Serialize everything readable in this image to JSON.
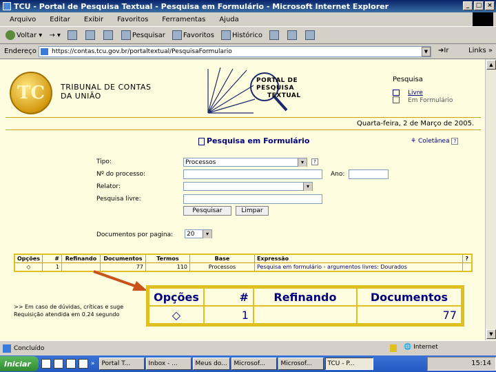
{
  "window": {
    "title": "TCU - Portal de Pesquisa Textual - Pesquisa em Formulário - Microsoft Internet Explorer"
  },
  "menu": [
    "Arquivo",
    "Editar",
    "Exibir",
    "Favoritos",
    "Ferramentas",
    "Ajuda"
  ],
  "toolbar": {
    "back": "Voltar",
    "search": "Pesquisar",
    "favorites": "Favoritos",
    "history": "Histórico"
  },
  "address": {
    "label": "Endereço",
    "url": "https://contas.tcu.gov.br/portaltextual/PesquisaFormulario",
    "go": "Ir",
    "links": "Links"
  },
  "header": {
    "org_line1": "TRIBUNAL DE CONTAS",
    "org_line2": "DA UNIÃO",
    "portal_line1": "PORTAL DE",
    "portal_line2": "PESQUISA",
    "portal_line3": "TEXTUAL",
    "pesquisa": "Pesquisa",
    "opt_livre": "Livre",
    "opt_formulario": "Em Formulário",
    "date": "Quarta-feira, 2 de Março de 2005."
  },
  "form": {
    "title": "Pesquisa em Formulário",
    "coletanea": "Coletânea",
    "tipo_label": "Tipo:",
    "tipo_value": "Processos",
    "processo_label": "Nº do processo:",
    "ano_label": "Ano:",
    "relator_label": "Relator:",
    "livre_label": "Pesquisa livre:",
    "search_btn": "Pesquisar",
    "clear_btn": "Limpar",
    "docs_label": "Documentos por pagina:",
    "docs_value": "20"
  },
  "results": {
    "headers": [
      "Opções",
      "#",
      "Refinando",
      "Documentos",
      "Termos",
      "Base",
      "Expressão",
      "?"
    ],
    "row": {
      "num": "1",
      "refinando": "",
      "documentos": "77",
      "termos": "110",
      "base": "Processos",
      "expressao": "Pesquisa em formulário - argumentos livres: Dourados"
    }
  },
  "zoom": {
    "headers": [
      "Opções",
      "#",
      "Refinando",
      "Documentos"
    ],
    "row": {
      "num": "1",
      "refinando": "",
      "documentos": "77"
    }
  },
  "footer": {
    "line1": ">> Em caso de dúvidas, críticas e suge",
    "line2": "Requisição atendida em 0.24 segundo"
  },
  "status": {
    "left": "Concluído",
    "zone": "Internet"
  },
  "taskbar": {
    "start": "Iniciar",
    "items": [
      "Portal T...",
      "Inbox - ...",
      "Meus do...",
      "Microsof...",
      "Microsof...",
      "TCU - P..."
    ],
    "clock": "15:14"
  }
}
